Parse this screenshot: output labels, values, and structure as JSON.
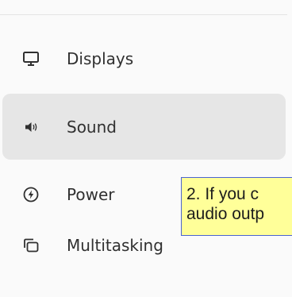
{
  "sidebar": {
    "items": [
      {
        "label": "Displays",
        "icon": "monitor-icon",
        "selected": false
      },
      {
        "label": "Sound",
        "icon": "speaker-icon",
        "selected": true
      },
      {
        "label": "Power",
        "icon": "power-bolt-icon",
        "selected": false
      },
      {
        "label": "Multitasking",
        "icon": "multitasking-icon",
        "selected": false
      }
    ]
  },
  "tooltip": {
    "line1": "2. If you c",
    "line2": "audio outp"
  },
  "colors": {
    "background": "#fafafa",
    "selected_item": "#e6e6e6",
    "text": "#303030",
    "tooltip_background": "#ffff99",
    "tooltip_border": "#4a63d0"
  }
}
